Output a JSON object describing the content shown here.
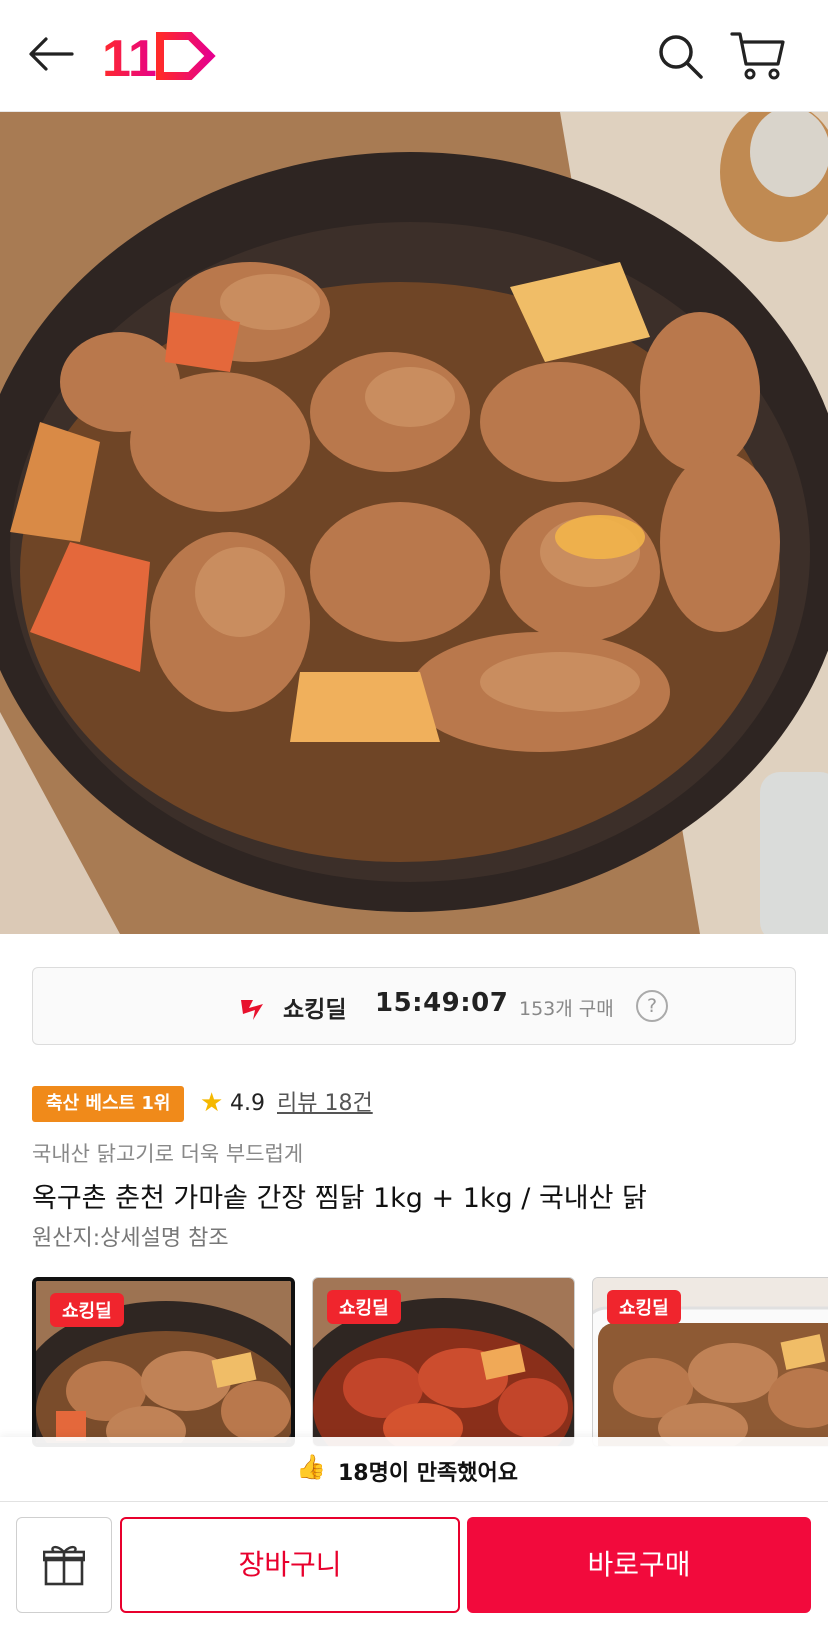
{
  "header": {
    "back_icon": "arrow-left-icon",
    "logo_text": "11",
    "search_icon": "search-icon",
    "cart_icon": "cart-icon",
    "brand_color": "#f20a3c"
  },
  "deal": {
    "icon": "shocking-deal-icon",
    "title": "쇼킹딜",
    "timer": "15:49:07",
    "purchase_count": "153개 구매",
    "help_label": "?"
  },
  "product": {
    "badge": "축산 베스트 1위",
    "rating": "4.9",
    "reviews": "리뷰 18건",
    "subtitle": "국내산 닭고기로 더욱 부드럽게",
    "title": "옥구촌 춘천 가마솥 간장 찜닭 1kg + 1kg / 국내산 닭",
    "origin": "원산지:상세설명 참조"
  },
  "options": [
    {
      "badge": "쇼킹딜"
    },
    {
      "badge": "쇼킹딜"
    },
    {
      "badge": "쇼킹딜"
    }
  ],
  "satisfaction": {
    "icon": "thumbs-up-icon",
    "text": "18명이 만족했어요"
  },
  "bottom_bar": {
    "gift_icon": "gift-icon",
    "cart_label": "장바구니",
    "buy_label": "바로구매"
  }
}
